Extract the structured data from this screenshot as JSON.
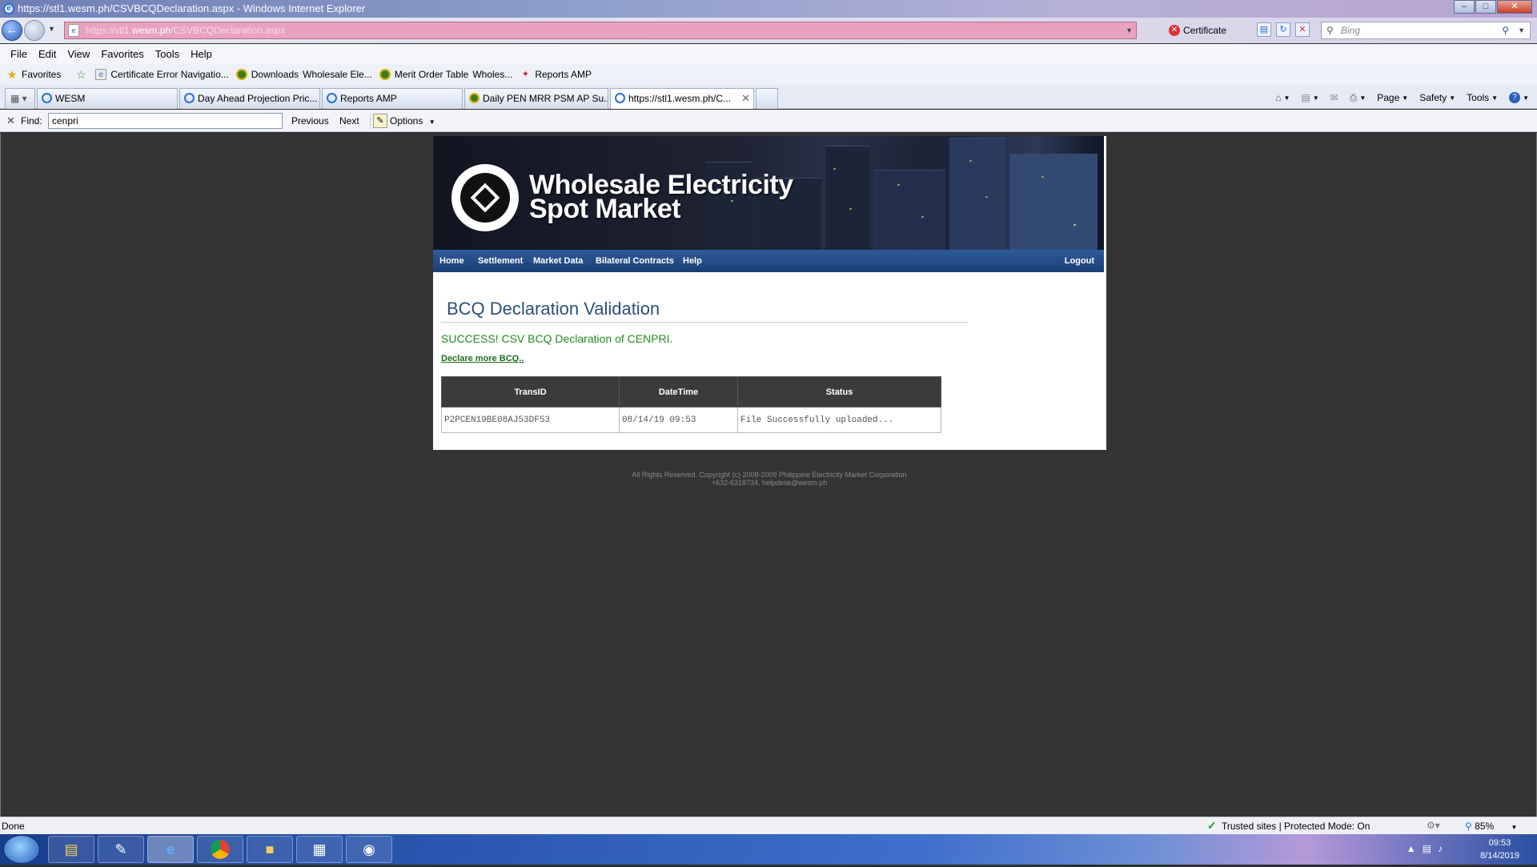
{
  "window": {
    "title": "https://stl1.wesm.ph/CSVBCQDeclaration.aspx - Windows Internet Explorer"
  },
  "address_bar": {
    "url_prefix": "https://stl1.",
    "url_host": "wesm.ph",
    "url_path": "/CSVBCQDeclaration.aspx",
    "certificate_error": "Certificate Error",
    "search_placeholder": "Bing"
  },
  "menu": [
    "File",
    "Edit",
    "View",
    "Favorites",
    "Tools",
    "Help"
  ],
  "favorites_bar": {
    "favorites_label": "Favorites",
    "items": [
      "Certificate Error Navigatio...",
      "Downloads",
      "Wholesale Ele...",
      "Merit Order Table",
      "Wholes...",
      "Reports AMP"
    ]
  },
  "tabs": [
    {
      "label": "WESM"
    },
    {
      "label": "Day Ahead Projection Pric..."
    },
    {
      "label": "Reports AMP"
    },
    {
      "label": "Daily PEN MRR PSM AP Su..."
    },
    {
      "label": "https://stl1.wesm.ph/C..."
    }
  ],
  "command_bar": {
    "page": "Page",
    "safety": "Safety",
    "tools": "Tools"
  },
  "find_bar": {
    "label": "Find:",
    "value": "cenpri",
    "previous": "Previous",
    "next": "Next",
    "options": "Options"
  },
  "site": {
    "brand_line1": "Wholesale Electricity",
    "brand_line2": "Spot Market",
    "nav": [
      "Home",
      "Settlement",
      "Market Data",
      "Bilateral Contracts",
      "Help"
    ],
    "logout": "Logout",
    "page_title": "BCQ Declaration Validation",
    "success_message": "SUCCESS! CSV BCQ Declaration of CENPRI.",
    "declare_more": "Declare more BCQ..",
    "table": {
      "headers": [
        "TransID",
        "DateTime",
        "Status"
      ],
      "rows": [
        [
          "P2PCEN19BE08AJ53DF53",
          "08/14/19 09:53",
          "File Successfully uploaded..."
        ]
      ]
    },
    "footer_line1": "All Rights Reserved. Copyright (c) 2008-2009 Philippine Electricity Market Corporation",
    "footer_line2": "+632-6318734, helpdesk@wesm.ph"
  },
  "status_bar": {
    "status": "Done",
    "zone": "Trusted sites | Protected Mode: On",
    "zoom": "85%"
  },
  "taskbar": {
    "time": "09:53",
    "date": "8/14/2019"
  }
}
